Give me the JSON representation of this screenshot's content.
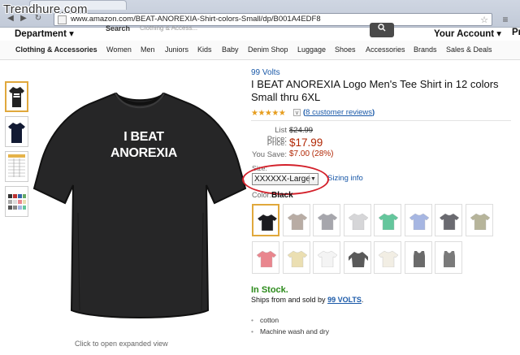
{
  "watermark": "Trendhure.com",
  "browser": {
    "url": "www.amazon.com/BEAT-ANOREXIA-Shirt-colors-Small/dp/B001A4EDF8"
  },
  "header": {
    "department": "Department ▾",
    "search_label": "Search",
    "search_placeholder": "Clothing & Access...",
    "account": "Your Account ▾",
    "extra": "Pr"
  },
  "categories": [
    "Clothing & Accessories",
    "Women",
    "Men",
    "Juniors",
    "Kids",
    "Baby",
    "Denim Shop",
    "Luggage",
    "Shoes",
    "Accessories",
    "Brands",
    "Sales & Deals"
  ],
  "main_image": {
    "shirt_line1": "I BEAT",
    "shirt_line2": "ANOREXIA",
    "expand_text": "Click to open expanded view"
  },
  "product": {
    "brand": "99 Volts",
    "title": "I BEAT ANOREXIA Logo Men's Tee Shirt in 12 colors Small thru 6XL",
    "stars": "★★★★★",
    "reviews_open": "(",
    "reviews_link": "8 customer reviews",
    "reviews_close": ")",
    "list_price_label": "List Price:",
    "list_price": "$24.99",
    "price_label": "Price:",
    "price": "$17.99",
    "save_label": "You Save:",
    "save": "$7.00 (28%)",
    "size_label": "Size:",
    "size_value": "XXXXXX-Large",
    "sizing_info": "Sizing info",
    "color_label": "Color:",
    "color_value": "Black",
    "stock": "In Stock.",
    "ship_prefix": "Ships from and sold by ",
    "seller": "99 VOLTS",
    "ship_suffix": ".",
    "bullets": [
      "cotton",
      "Machine wash and dry"
    ]
  },
  "swatch_colors": [
    "#1b1b1f",
    "#b8aca4",
    "#a6a6ac",
    "#d6d6d8",
    "#64c69c",
    "#a6b6e2",
    "#6a6a70",
    "#b6b49a",
    "#e9868e",
    "#ebdfb2",
    "#f4f4f4",
    "#5a5a5a",
    "#f2eee4",
    "#6b6b6b",
    "#7a7a7a"
  ]
}
